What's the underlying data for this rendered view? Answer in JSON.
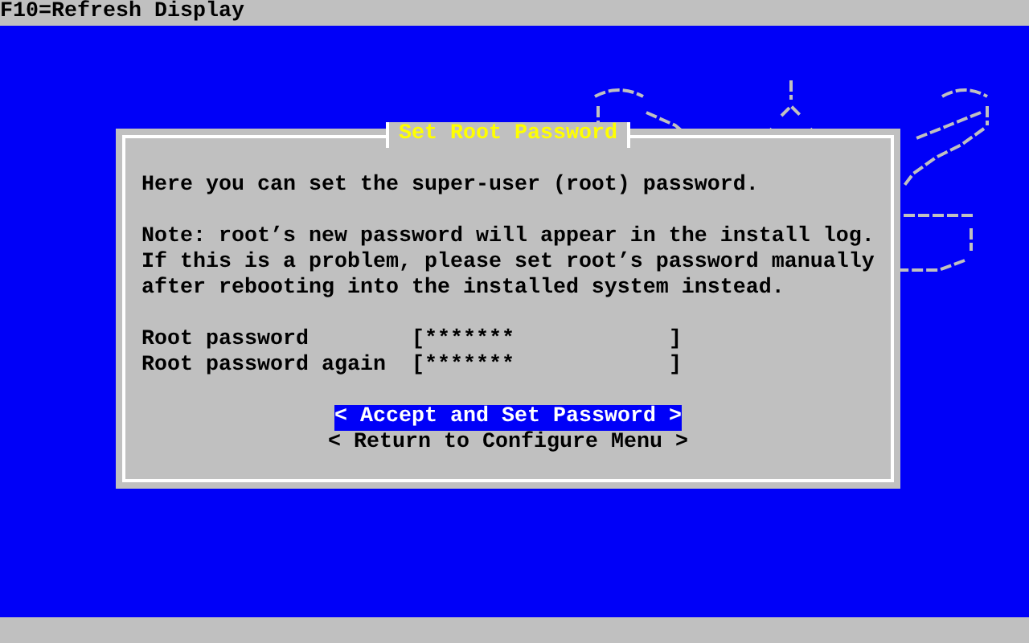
{
  "top_bar": {
    "hint": "F10=Refresh Display"
  },
  "dialog": {
    "title": "Set Root Password",
    "paragraphs": [
      "Here you can set the super-user (root) password.",
      "Note: root’s new password will appear in the install log.\nIf this is a problem, please set root’s password manually\nafter rebooting into the installed system instead."
    ],
    "fields": [
      {
        "label": "Root password",
        "left": "[",
        "value": "*******",
        "right": "]"
      },
      {
        "label": "Root password again",
        "left": "[",
        "value": "*******",
        "right": "]"
      }
    ],
    "buttons": [
      {
        "label": "< Accept and Set Password >",
        "selected": true
      },
      {
        "label": "< Return to Configure Menu >",
        "selected": false
      }
    ]
  }
}
